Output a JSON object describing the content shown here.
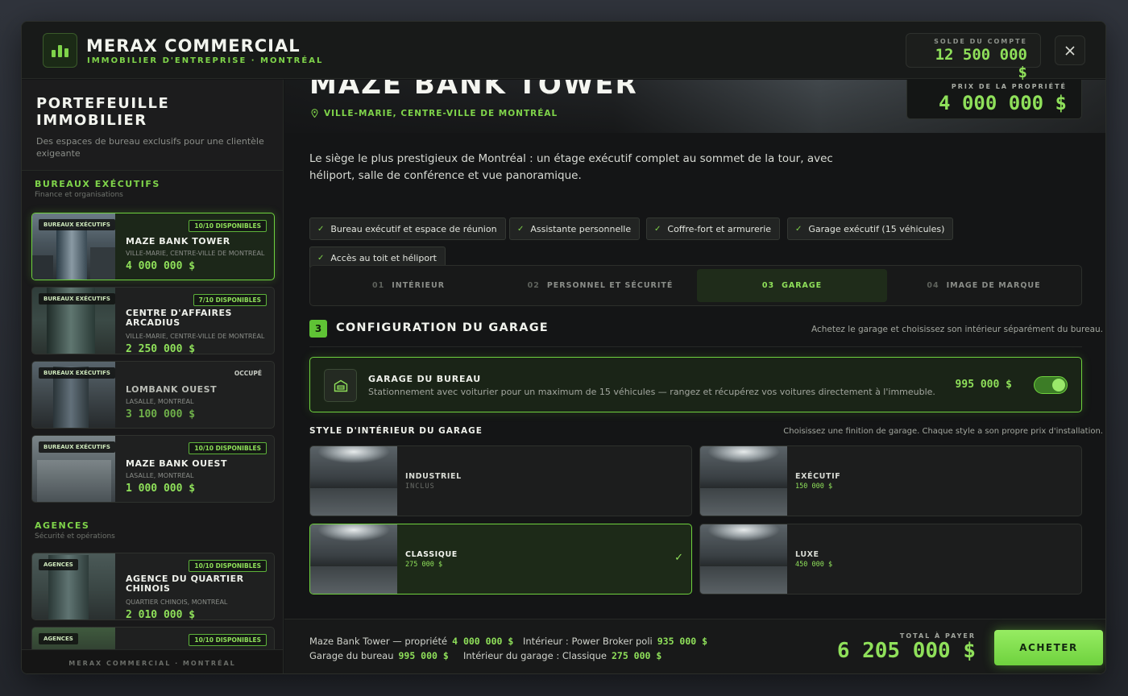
{
  "app": {
    "name": "MERAX COMMERCIAL",
    "subtitle": "IMMOBILIER D'ENTREPRISE · MONTRÉAL",
    "balance_label": "SOLDE DU COMPTE",
    "balance_value": "12 500 000 $",
    "close_icon": "close-icon",
    "accent_color": "#6fd23e"
  },
  "sidebar": {
    "title": "PORTEFEUILLE IMMOBILIER",
    "description": "Des espaces de bureau exclusifs pour une clientèle exigeante",
    "sections": [
      {
        "title": "BUREAUX EXÉCUTIFS",
        "subtitle": "Finance et organisations",
        "cards": [
          {
            "tag": "BUREAUX EXÉCUTIFS",
            "availability": "10/10 DISPONIBLES",
            "name": "MAZE BANK TOWER",
            "location": "VILLE-MARIE, CENTRE-VILLE DE MONTRÉAL",
            "price": "4 000 000 $"
          },
          {
            "tag": "BUREAUX EXÉCUTIFS",
            "availability": "7/10 DISPONIBLES",
            "name": "CENTRE D'AFFAIRES ARCADIUS",
            "location": "VILLE-MARIE, CENTRE-VILLE DE MONTRÉAL",
            "price": "2 250 000 $"
          },
          {
            "tag": "BUREAUX EXÉCUTIFS",
            "availability": "OCCUPÉ",
            "name": "LOMBANK OUEST",
            "location": "LASALLE, MONTRÉAL",
            "price": "3 100 000 $"
          },
          {
            "tag": "BUREAUX EXÉCUTIFS",
            "availability": "10/10 DISPONIBLES",
            "name": "MAZE BANK OUEST",
            "location": "LASALLE, MONTRÉAL",
            "price": "1 000 000 $"
          }
        ]
      },
      {
        "title": "AGENCES",
        "subtitle": "Sécurité et opérations",
        "cards": [
          {
            "tag": "AGENCES",
            "availability": "10/10 DISPONIBLES",
            "name": "AGENCE DU QUARTIER CHINOIS",
            "location": "QUARTIER CHINOIS, MONTRÉAL",
            "price": "2 010 000 $"
          },
          {
            "tag": "AGENCES",
            "availability": "10/10 DISPONIBLES"
          }
        ]
      }
    ],
    "footer": "MERAX COMMERCIAL · MONTRÉAL"
  },
  "property": {
    "title": "MAZE BANK TOWER",
    "location": "VILLE-MARIE, CENTRE-VILLE DE MONTRÉAL",
    "location_icon": "map-pin-icon",
    "price_label": "PRIX DE LA PROPRIÉTÉ",
    "price": "4 000 000 $",
    "description": "Le siège le plus prestigieux de Montréal : un étage exécutif complet au sommet de la tour, avec héliport, salle de conférence et vue panoramique.",
    "features": [
      "Bureau exécutif et espace de réunion",
      "Assistante personnelle",
      "Coffre-fort et armurerie",
      "Garage exécutif (15 véhicules)",
      "Accès au toit et héliport"
    ]
  },
  "tabs": [
    {
      "num": "01",
      "label": "INTÉRIEUR"
    },
    {
      "num": "02",
      "label": "PERSONNEL ET SÉCURITÉ"
    },
    {
      "num": "03",
      "label": "GARAGE"
    },
    {
      "num": "04",
      "label": "IMAGE DE MARQUE"
    }
  ],
  "config": {
    "step": "3",
    "title": "CONFIGURATION DU GARAGE",
    "hint": "Achetez le garage et choisissez son intérieur séparément du bureau.",
    "garage": {
      "icon": "garage-icon",
      "title": "GARAGE DU BUREAU",
      "description": "Stationnement avec voiturier pour un maximum de 15 véhicules — rangez et récupérez vos voitures directement à l'immeuble.",
      "price": "995 000 $",
      "enabled": true
    },
    "style_title": "STYLE D'INTÉRIEUR DU GARAGE",
    "style_hint": "Choisissez une finition de garage. Chaque style a son propre prix d'installation.",
    "styles": [
      {
        "name": "INDUSTRIEL",
        "price": "INCLUS"
      },
      {
        "name": "EXÉCUTIF",
        "price": "150 000 $"
      },
      {
        "name": "CLASSIQUE",
        "price": "275 000 $"
      },
      {
        "name": "LUXE",
        "price": "450 000 $"
      }
    ],
    "selected_style": "CLASSIQUE"
  },
  "summary": {
    "lines": [
      {
        "label": "Maze Bank Tower — propriété",
        "value": "4 000 000 $"
      },
      {
        "label": "Intérieur : Power Broker poli",
        "value": "935 000 $"
      },
      {
        "label": "Garage du bureau",
        "value": "995 000 $"
      },
      {
        "label": "Intérieur du garage : Classique",
        "value": "275 000 $"
      }
    ],
    "total_label": "TOTAL À PAYER",
    "total": "6 205 000 $",
    "buy_label": "ACHETER"
  }
}
